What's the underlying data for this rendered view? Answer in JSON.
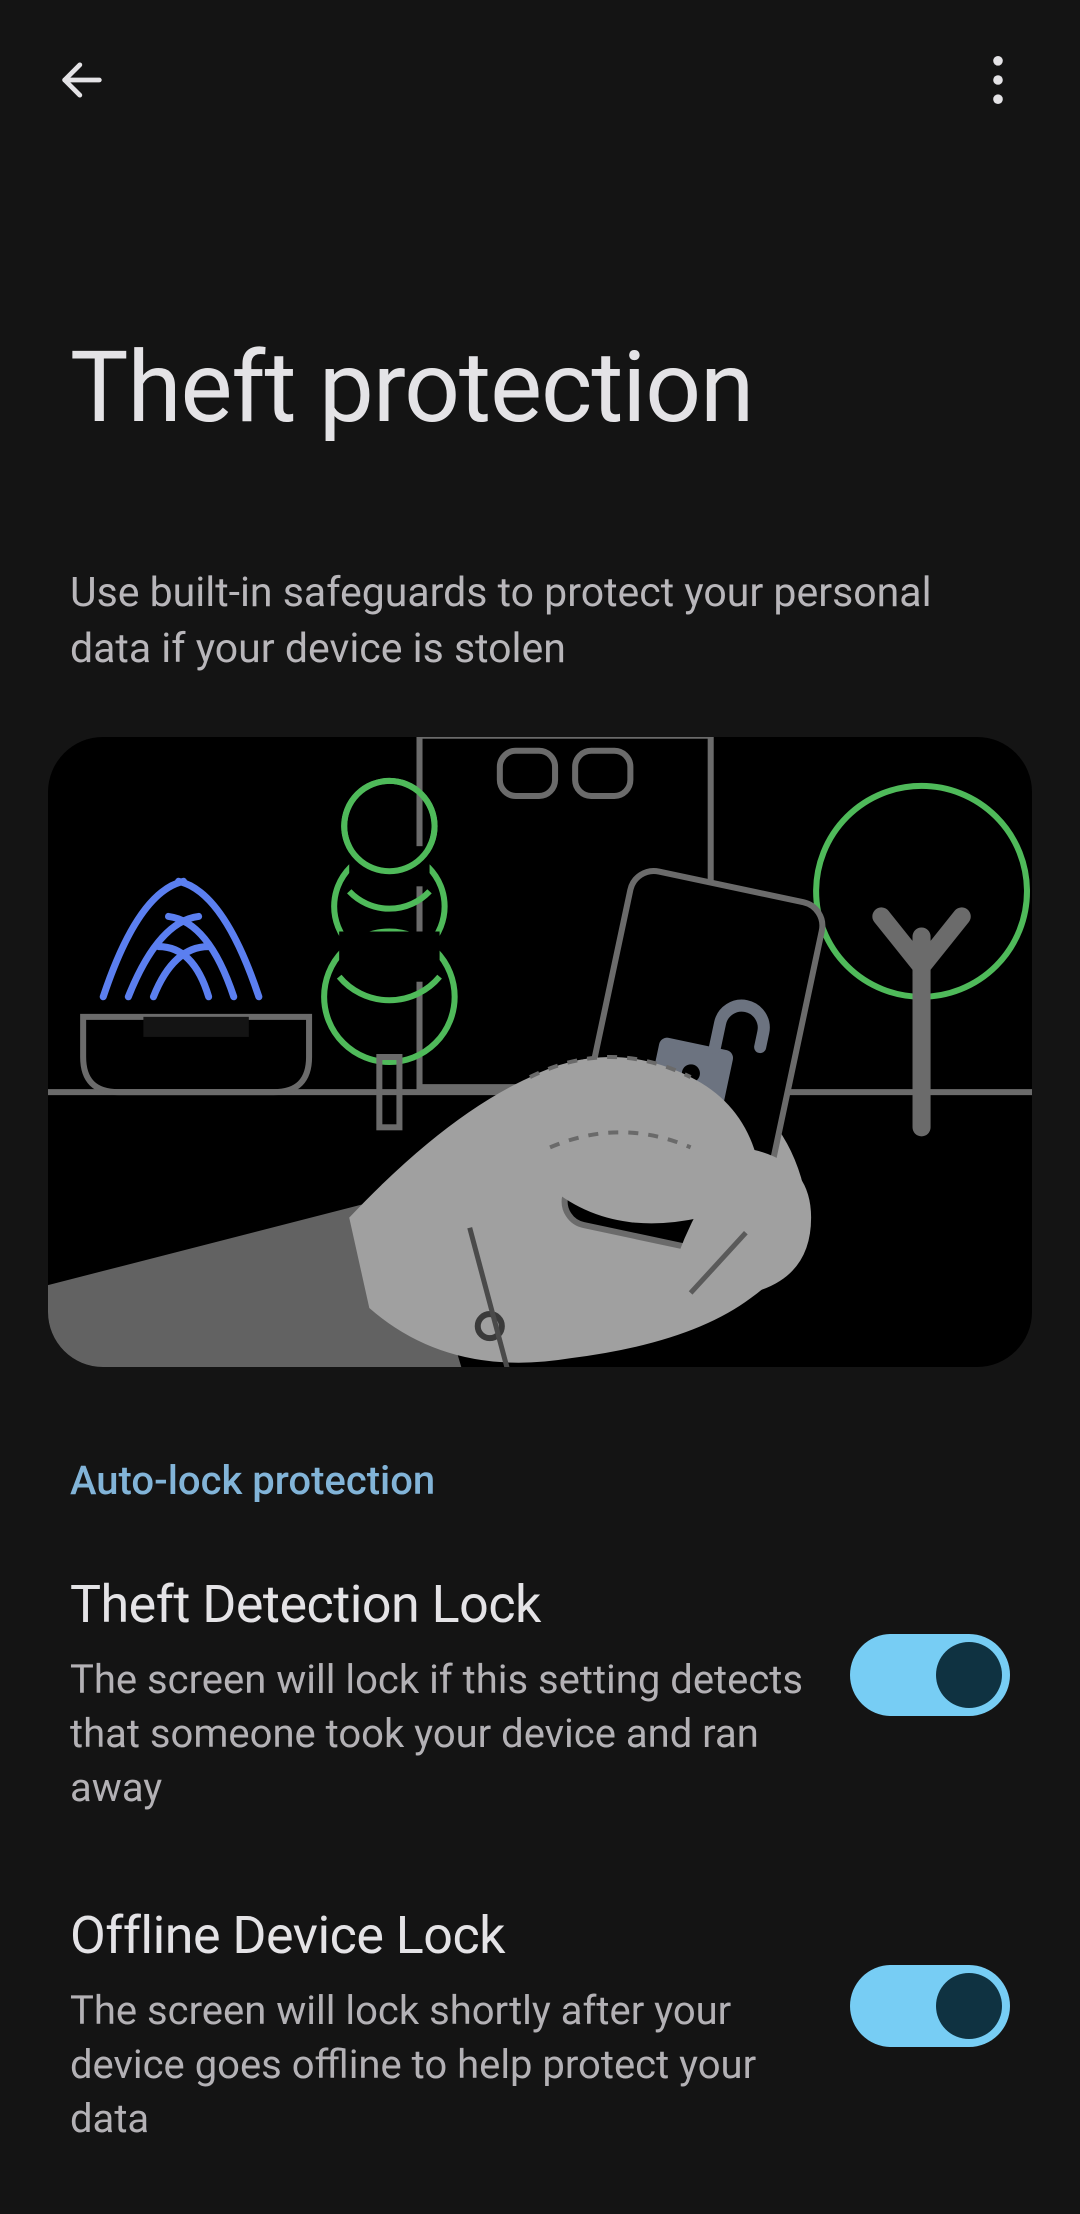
{
  "header": {
    "title": "Theft protection",
    "subtitle": "Use built-in safeguards to protect your personal data if your device is stolen"
  },
  "section": {
    "label": "Auto-lock protection"
  },
  "settings": [
    {
      "title": "Theft Detection Lock",
      "description": "The screen will lock if this setting detects that someone took your device and ran away",
      "enabled": true
    },
    {
      "title": "Offline Device Lock",
      "description": "The screen will lock shortly after your device goes offline to help protect your data",
      "enabled": true
    }
  ]
}
